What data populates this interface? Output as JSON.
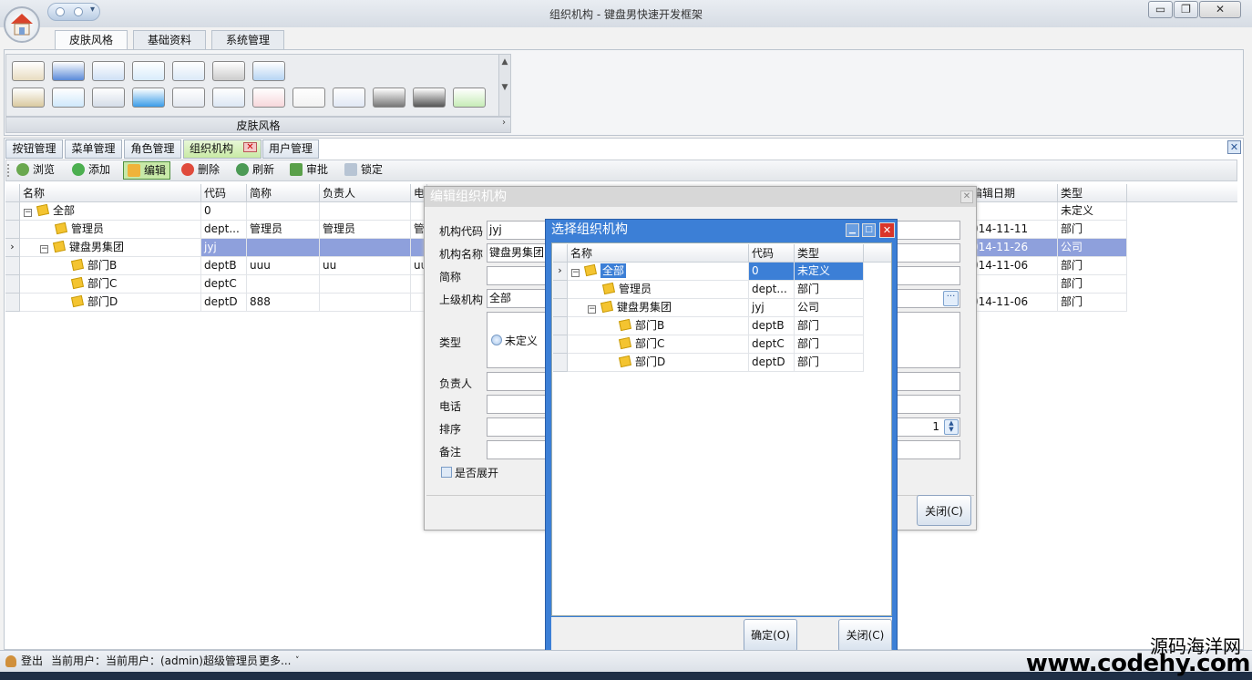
{
  "window": {
    "title": "组织机构 - 键盘男快速开发框架",
    "minimize": "▭",
    "restore": "❐",
    "close": "✕"
  },
  "ribbon": {
    "tabs": [
      "皮肤风格",
      "基础资料",
      "系统管理"
    ],
    "group_label": "皮肤风格",
    "swatch_colors_row1": [
      "#e8dcc0",
      "#5a8ad8",
      "#cfe0f5",
      "#d8ecfb",
      "#dbe9f7",
      "#cccccc",
      "#b6d4f3"
    ],
    "swatch_colors_row2": [
      "#d9c9a0",
      "#cfe8fb",
      "#d5dde8",
      "#3b9de8",
      "#e3e8f0",
      "#dce7f4",
      "#f7d7db",
      "#f2f2f2",
      "#e1e8f5",
      "#777777",
      "#555555",
      "#c6ecb6"
    ]
  },
  "doc_tabs": [
    {
      "label": "按钮管理"
    },
    {
      "label": "菜单管理"
    },
    {
      "label": "角色管理"
    },
    {
      "label": "组织机构",
      "active": true
    },
    {
      "label": "用户管理"
    }
  ],
  "tab_close": "✕",
  "toolbar": {
    "browse": "浏览",
    "add": "添加",
    "edit": "编辑",
    "delete": "删除",
    "refresh": "刷新",
    "approve": "审批",
    "lock": "锁定"
  },
  "grid": {
    "headers": {
      "name": "名称",
      "code": "代码",
      "short": "简称",
      "owner": "负责人",
      "phone": "电",
      "edit_date": "编辑日期",
      "type": "类型"
    },
    "rows": [
      {
        "name": "全部",
        "code": "0",
        "short": "",
        "owner": "",
        "phone": "",
        "edit_date": "",
        "type": "未定义"
      },
      {
        "name": "管理员",
        "code": "dept...",
        "short": "管理员",
        "owner": "管理员",
        "phone": "管",
        "edit_date": "014-11-11",
        "type": "部门"
      },
      {
        "name": "键盘男集团",
        "code": "jyj",
        "short": "",
        "owner": "",
        "phone": "",
        "edit_date": "014-11-26",
        "type": "公司"
      },
      {
        "name": "部门B",
        "code": "deptB",
        "short": "uuu",
        "owner": "uu",
        "phone": "uu",
        "edit_date": "014-11-06",
        "type": "部门"
      },
      {
        "name": "部门C",
        "code": "deptC",
        "short": "",
        "owner": "",
        "phone": "",
        "edit_date": "",
        "type": "部门"
      },
      {
        "name": "部门D",
        "code": "deptD",
        "short": "888",
        "owner": "",
        "phone": "",
        "edit_date": "014-11-06",
        "type": "部门"
      }
    ]
  },
  "edit_dialog": {
    "title": "编辑组织机构",
    "labels": {
      "code": "机构代码",
      "name": "机构名称",
      "short": "简称",
      "parent": "上级机构",
      "type": "类型",
      "owner": "负责人",
      "phone": "电话",
      "sort": "排序",
      "note": "备注"
    },
    "values": {
      "code": "jyj",
      "name": "键盘男集团",
      "parent": "全部",
      "type_option": "未定义",
      "sort": "1"
    },
    "expand_label": "是否展开",
    "close": "关闭(C)"
  },
  "select_dialog": {
    "title": "选择组织机构",
    "headers": {
      "name": "名称",
      "code": "代码",
      "type": "类型"
    },
    "rows": [
      {
        "name": "全部",
        "code": "0",
        "type": "未定义"
      },
      {
        "name": "管理员",
        "code": "dept...",
        "type": "部门"
      },
      {
        "name": "键盘男集团",
        "code": "jyj",
        "type": "公司"
      },
      {
        "name": "部门B",
        "code": "deptB",
        "type": "部门"
      },
      {
        "name": "部门C",
        "code": "deptC",
        "type": "部门"
      },
      {
        "name": "部门D",
        "code": "deptD",
        "type": "部门"
      }
    ],
    "ok": "确定(O)",
    "close": "关闭(C)"
  },
  "status": {
    "logout": "登出",
    "current_user": "当前用户：当前用户：(admin)超级管理员",
    "more": "更多..."
  },
  "watermark": {
    "cn": "源码海洋网",
    "en": "www.codehy.com"
  }
}
